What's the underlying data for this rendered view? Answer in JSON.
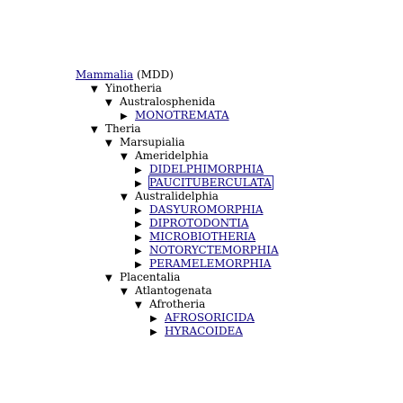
{
  "tree": {
    "root_link": "Mammalia",
    "root_suffix": " (MDD)",
    "toggle_expanded": "▼",
    "toggle_collapsed": "▶",
    "nodes": [
      {
        "label": "Yinotheria"
      },
      {
        "label": "Australosphenida"
      },
      {
        "label": "MONOTREMATA"
      },
      {
        "label": "Theria"
      },
      {
        "label": "Marsupialia"
      },
      {
        "label": "Ameridelphia"
      },
      {
        "label": "DIDELPHIMORPHIA"
      },
      {
        "label": "PAUCITUBERCULATA"
      },
      {
        "label": "Australidelphia"
      },
      {
        "label": "DASYUROMORPHIA"
      },
      {
        "label": "DIPROTODONTIA"
      },
      {
        "label": "MICROBIOTHERIA"
      },
      {
        "label": "NOTORYCTEMORPHIA"
      },
      {
        "label": "PERAMELEMORPHIA"
      },
      {
        "label": "Placentalia"
      },
      {
        "label": "Atlantogenata"
      },
      {
        "label": "Afrotheria"
      },
      {
        "label": "AFROSORICIDA"
      },
      {
        "label": "HYRACOIDEA"
      }
    ]
  }
}
